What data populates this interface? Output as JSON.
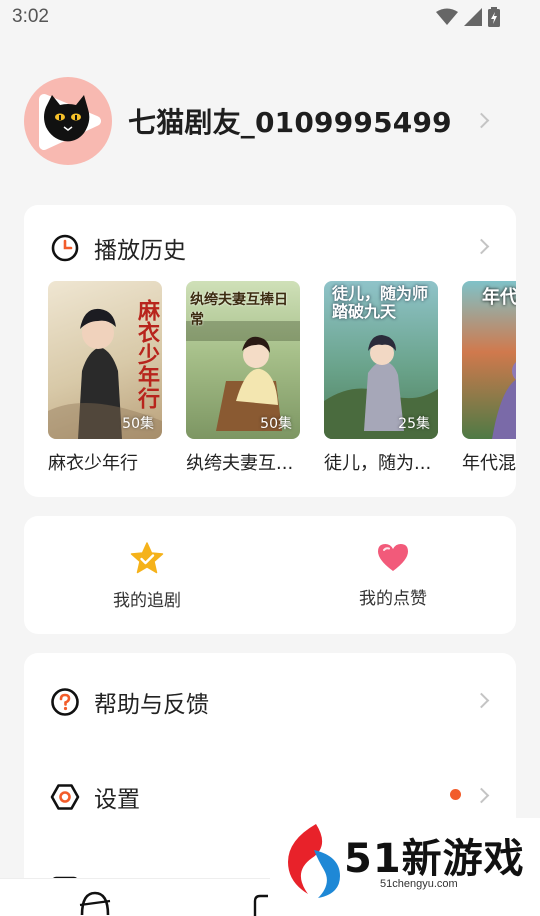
{
  "status_bar": {
    "time": "3:02"
  },
  "profile": {
    "username": "七猫剧友_0109995499"
  },
  "history": {
    "title": "播放历史",
    "items": [
      {
        "title": "麻衣少年行",
        "episodes": "50集",
        "cover_text": "麻衣少年行"
      },
      {
        "title": "纨绔夫妻互...",
        "episodes": "50集",
        "cover_text": "纨绔夫妻互捧日常"
      },
      {
        "title": "徒儿，随为...",
        "episodes": "25集",
        "cover_text": "徒儿，随为师踏破九天"
      },
      {
        "title": "年代混",
        "episodes": "",
        "cover_text": "年代"
      }
    ]
  },
  "shortcuts": [
    {
      "label": "我的追剧",
      "icon": "star-icon"
    },
    {
      "label": "我的点赞",
      "icon": "heart-icon"
    }
  ],
  "menu": [
    {
      "label": "帮助与反馈",
      "icon": "help-icon"
    },
    {
      "label": "设置",
      "icon": "settings-icon"
    }
  ],
  "watermark": {
    "text": "51新游戏",
    "url": "51chengyu.com"
  },
  "colors": {
    "accent": "#f25c2a",
    "star": "#f5b21a",
    "heart": "#f25a7a",
    "avatar_bg": "#f8b9b1"
  }
}
